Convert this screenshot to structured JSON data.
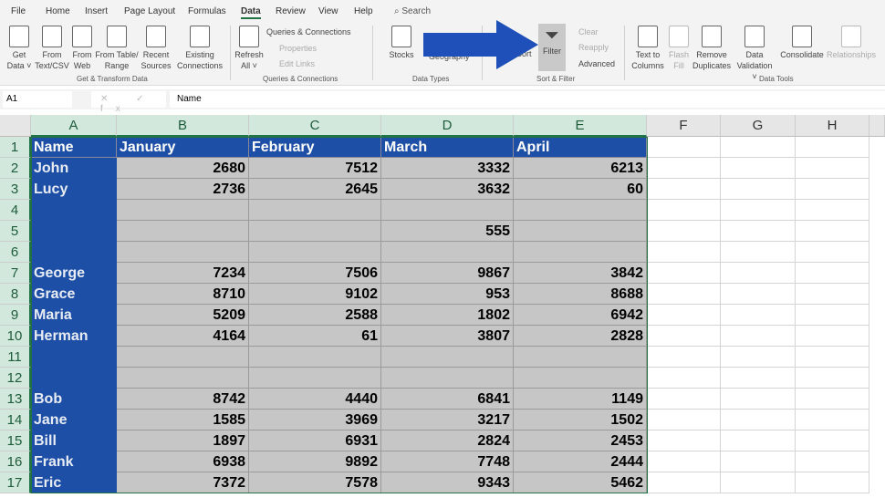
{
  "tabs": [
    "File",
    "Home",
    "Insert",
    "Page Layout",
    "Formulas",
    "Data",
    "Review",
    "View",
    "Help"
  ],
  "active_tab": "Data",
  "search_label": "Search",
  "ribbon": {
    "get_data": [
      "Get",
      "Data ˅"
    ],
    "from_text": [
      "From",
      "Text/CSV"
    ],
    "from_web": [
      "From",
      "Web"
    ],
    "from_table": [
      "From Table/",
      "Range"
    ],
    "recent": [
      "Recent",
      "Sources"
    ],
    "existing": [
      "Existing",
      "Connections"
    ],
    "group1": "Get & Transform Data",
    "refresh": [
      "Refresh",
      "All ˅"
    ],
    "queries": "Queries & Connections",
    "properties": "Properties",
    "edit_links": "Edit Links",
    "group2": "Queries & Connections",
    "stocks": "Stocks",
    "geography": "Geography",
    "group3": "Data Types",
    "sort": "Sort",
    "filter": "Filter",
    "clear": "Clear",
    "reapply": "Reapply",
    "advanced": "Advanced",
    "group4": "Sort & Filter",
    "text_to_columns": [
      "Text to",
      "Columns"
    ],
    "flash_fill": [
      "Flash",
      "Fill"
    ],
    "remove_duplicates": [
      "Remove",
      "Duplicates"
    ],
    "data_validation": [
      "Data",
      "Validation ˅"
    ],
    "consolidate": "Consolidate",
    "relationships": "Relationships",
    "group5": "Data Tools"
  },
  "formula_bar": {
    "name_box": "A1",
    "fx": "✕ ✓ fx",
    "value": "Name"
  },
  "columns": [
    "A",
    "B",
    "C",
    "D",
    "E",
    "F",
    "G",
    "H"
  ],
  "rows": [
    [
      "Name",
      "January",
      "February",
      "March",
      "April"
    ],
    [
      "John",
      "2680",
      "7512",
      "3332",
      "6213"
    ],
    [
      "Lucy",
      "2736",
      "2645",
      "3632",
      "60"
    ],
    [
      "",
      "",
      "",
      "",
      ""
    ],
    [
      "",
      "",
      "",
      "555",
      ""
    ],
    [
      "",
      "",
      "",
      "",
      ""
    ],
    [
      "George",
      "7234",
      "7506",
      "9867",
      "3842"
    ],
    [
      "Grace",
      "8710",
      "9102",
      "953",
      "8688"
    ],
    [
      "Maria",
      "5209",
      "2588",
      "1802",
      "6942"
    ],
    [
      "Herman",
      "4164",
      "61",
      "3807",
      "2828"
    ],
    [
      "",
      "",
      "",
      "",
      ""
    ],
    [
      "",
      "",
      "",
      "",
      ""
    ],
    [
      "Bob",
      "8742",
      "4440",
      "6841",
      "1149"
    ],
    [
      "Jane",
      "1585",
      "3969",
      "3217",
      "1502"
    ],
    [
      "Bill",
      "1897",
      "6931",
      "2824",
      "2453"
    ],
    [
      "Frank",
      "6938",
      "9892",
      "7748",
      "2444"
    ],
    [
      "Eric",
      "7372",
      "7578",
      "9343",
      "5462"
    ]
  ],
  "colors": {
    "selection_blue": "#1e4fa6",
    "selection_gray": "#c6c6c6",
    "arrow": "#1f4fb8",
    "excel_green": "#217346"
  }
}
